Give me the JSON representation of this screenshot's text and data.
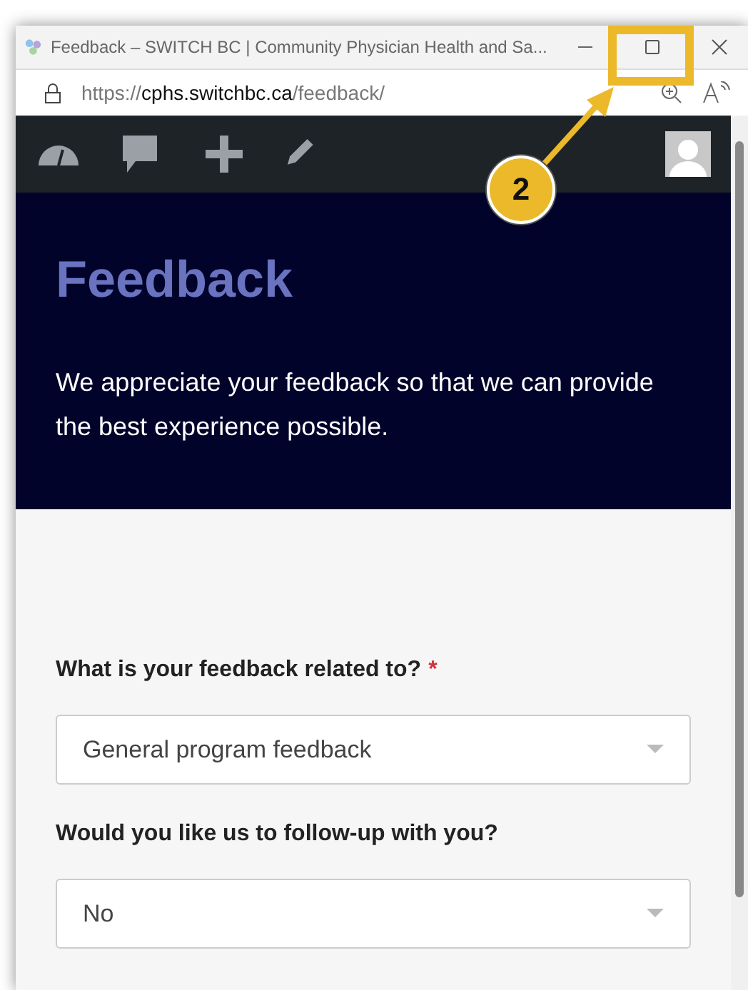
{
  "window": {
    "title": "Feedback – SWITCH BC | Community Physician Health and Sa..."
  },
  "address_bar": {
    "scheme": "https://",
    "host": "cphs.switchbc.ca",
    "path": "/feedback/"
  },
  "hero": {
    "title": "Feedback",
    "text": "We appreciate your feedback so that we can provide the best experience possible."
  },
  "form": {
    "fields": [
      {
        "label": "What is your feedback related to?",
        "required_mark": "*",
        "value": "General program feedback"
      },
      {
        "label": "Would you like us to follow-up with you?",
        "value": "No"
      }
    ]
  },
  "annotation": {
    "step": "2"
  }
}
